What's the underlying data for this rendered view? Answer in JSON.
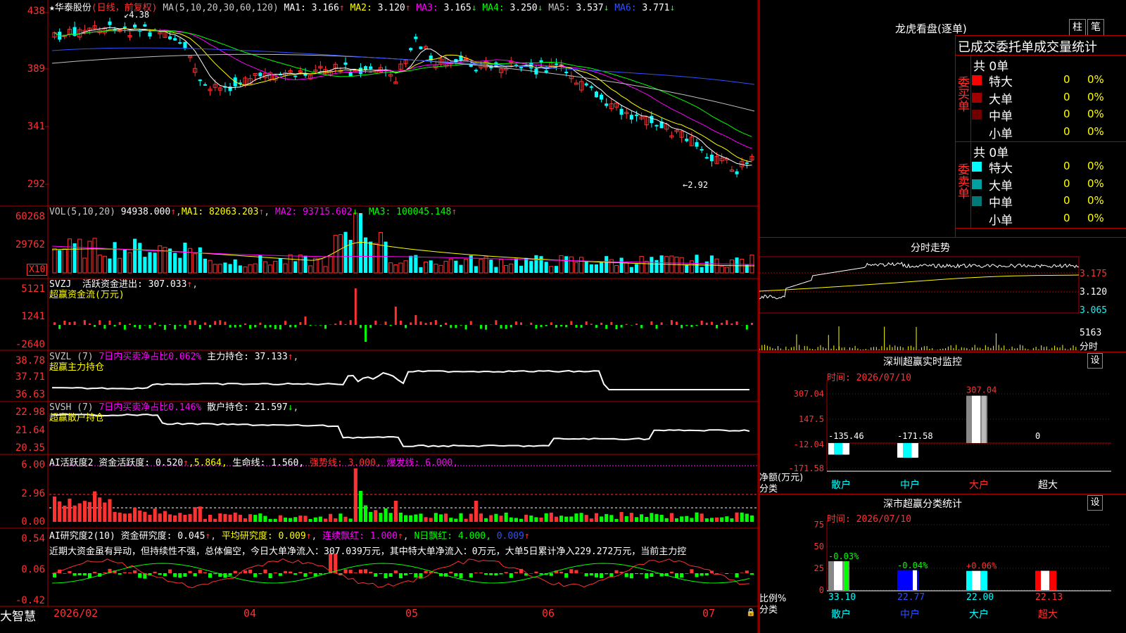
{
  "app_name": "大智慧",
  "stock": {
    "star": "★",
    "name": "华泰股份",
    "period": "(日线，前复权)",
    "ma_spec": "MA(5,10,20,30,60,120)",
    "ma": [
      {
        "label": "MA1:",
        "value": "3.166",
        "arrow": "↑",
        "color": "#ffffff"
      },
      {
        "label": "MA2:",
        "value": "3.120",
        "arrow": "↑",
        "color": "#ffff00"
      },
      {
        "label": "MA3:",
        "value": "3.165",
        "arrow": "↓",
        "color": "#ff00ff"
      },
      {
        "label": "MA4:",
        "value": "3.250",
        "arrow": "↓",
        "color": "#00ff00"
      },
      {
        "label": "MA5:",
        "value": "3.537",
        "arrow": "↓",
        "color": "#c0c0c0"
      },
      {
        "label": "MA6:",
        "value": "3.771",
        "arrow": "↓",
        "color": "#3050ff"
      }
    ],
    "high_marker": "4.38",
    "low_marker": "2.92"
  },
  "axes": {
    "price_ticks": [
      "438",
      "389",
      "341",
      "292"
    ],
    "vol_ticks": [
      "60268",
      "29762"
    ],
    "vol_unit": "X10",
    "svzj_ticks": [
      "5121",
      "1241",
      "-2640"
    ],
    "svzl_ticks": [
      "38.78",
      "37.71",
      "36.63"
    ],
    "svsh_ticks": [
      "22.98",
      "21.64",
      "20.35"
    ],
    "ai_ticks": [
      "6.00",
      "2.96",
      "0.00"
    ],
    "ai2_ticks": [
      "0.54",
      "0.06",
      "-0.42"
    ],
    "date_labels": [
      "2026/02",
      "04",
      "05",
      "06",
      "07"
    ]
  },
  "indicators": {
    "vol": {
      "head": "VOL(5,10,20)",
      "val": "94938.000",
      "arr": "↑",
      "ma1": "MA1: 82063.203",
      "ma1_arr": "↑",
      "ma2": "MA2: 93715.602",
      "ma2_arr": "↓",
      "ma3": "MA3: 100045.148",
      "ma3_arr": "↑"
    },
    "svzj": {
      "head": "SVZJ  活跃资金进出: 307.033",
      "arr": "↑",
      "tail": ",",
      "sub": "超赢资金流(万元)"
    },
    "svzl": {
      "head": "SVZL (7)",
      "red": "7日内买卖净占比0.062%",
      "mid": "主力持仓: 37.133",
      "arr": "↑",
      "tail": ",",
      "sub": "超赢主力持仓"
    },
    "svsh": {
      "head": "SVSH (7)",
      "red": "7日内买卖净占比0.146%",
      "mid": "散户持仓: 21.597",
      "arr": "↓",
      "tail": ",",
      "sub": "超赢散户持仓"
    },
    "ai": {
      "head": "AI活跃度2 资金活跃度: 0.520",
      "arr": "↑",
      "v2": ",5.864,",
      "life": "生命线: 1.560,",
      "strong": "强势线: 3.000,",
      "burst": "爆发线: 6.000,"
    },
    "ai2": {
      "head": "AI研究度2(10) 资金研究度: 0.045",
      "arr": "↑",
      "avg": "平均研究度: 0.009",
      "avg_arr": "↑",
      "cont": "连续飘红: 1.000",
      "cont_arr": "↑",
      "n": "N日飘红: 4.000,",
      "n2": "0.009",
      "n2_arr": "↑",
      "comment": "近期大资金虽有异动，但持续性不强，总体偏空，今日大单净流入：307.039万元，其中特大单净流入：0万元，大单5日累计净入229.272万元，当前主力控"
    }
  },
  "right": {
    "dragon_title": "龙虎看盘(逐单)",
    "btn_zhu": "柱",
    "btn_bi": "笔",
    "stats_title": "已成交委托单成交量统计",
    "buy": {
      "side": "委买单",
      "total": "共 0单",
      "rows": [
        {
          "label": "特大",
          "count": "0",
          "pct": "0%",
          "color": "#ff0000"
        },
        {
          "label": "大单",
          "count": "0",
          "pct": "0%",
          "color": "#a00000"
        },
        {
          "label": "中单",
          "count": "0",
          "pct": "0%",
          "color": "#700000"
        },
        {
          "label": "小单",
          "count": "0",
          "pct": "0%",
          "color": "#000000"
        }
      ]
    },
    "sell": {
      "side": "委卖单",
      "total": "共 0单",
      "rows": [
        {
          "label": "特大",
          "count": "0",
          "pct": "0%",
          "color": "#00ffff"
        },
        {
          "label": "大单",
          "count": "0",
          "pct": "0%",
          "color": "#00a0a0"
        },
        {
          "label": "中单",
          "count": "0",
          "pct": "0%",
          "color": "#007878"
        },
        {
          "label": "小单",
          "count": "0",
          "pct": "0%",
          "color": "#000000"
        }
      ]
    },
    "intraday": {
      "title": "分时走势",
      "ticks": [
        "3.175",
        "3.120",
        "3.065"
      ],
      "vol": "5163",
      "vol_unit": "分时"
    },
    "sz_monitor": {
      "title": "深圳超赢实时监控",
      "settings": "设",
      "time": "时间: 2026/07/10",
      "yticks": [
        "307.04",
        "147.5",
        "-12.04",
        "-171.58"
      ],
      "values": [
        {
          "cat": "散户",
          "val": "-135.46"
        },
        {
          "cat": "中户",
          "val": "-171.58"
        },
        {
          "cat": "大户",
          "val": "307.04"
        },
        {
          "cat": "超大",
          "val": "0"
        }
      ],
      "ylabel": "净额(万元)",
      "xlabel": "分类"
    },
    "sz_class": {
      "title": "深市超赢分类统计",
      "settings": "设",
      "time": "时间: 2026/07/10",
      "yticks": [
        "75",
        "50",
        "25",
        "0"
      ],
      "values": [
        {
          "cat": "散户",
          "val": "33.10",
          "chg": "-0.03%"
        },
        {
          "cat": "中户",
          "val": "22.77",
          "chg": "-0.04%"
        },
        {
          "cat": "大户",
          "val": "22.00",
          "chg": "+0.06%"
        },
        {
          "cat": "超大",
          "val": "22.13",
          "chg": ""
        }
      ],
      "ylabel": "比例%",
      "xlabel": "分类"
    }
  },
  "colors": {
    "up": "#ff3232",
    "down": "#00ffff",
    "grid": "#b00000",
    "yellow": "#ffff00",
    "magenta": "#ff00ff",
    "green": "#00ff00"
  }
}
